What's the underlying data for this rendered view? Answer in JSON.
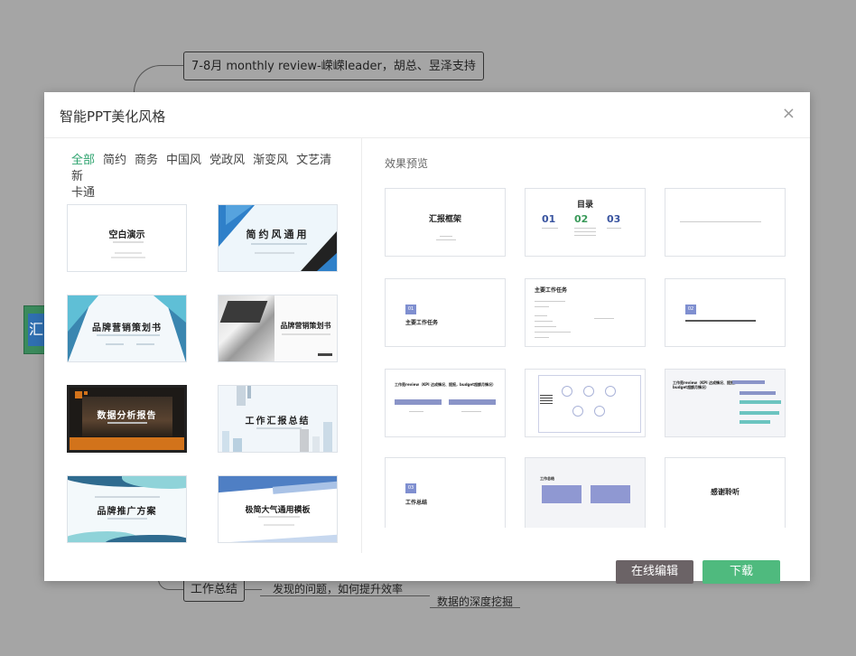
{
  "background": {
    "top_node": "7-8月 monthly review-嵘嵘leader，胡总、昱泽支持",
    "bottom_node": "工作总结",
    "bottom_branch_1": "发现的问题，如何提升效率",
    "bottom_branch_2": "数据的深度挖掘",
    "left_node_glyph": "汇"
  },
  "modal": {
    "title": "智能PPT美化风格",
    "close_glyph": "×",
    "categories": [
      "全部",
      "简约",
      "商务",
      "中国风",
      "党政风",
      "渐变风",
      "文艺清新",
      "卡通"
    ],
    "active_category": "全部",
    "templates": [
      {
        "title": "空白演示"
      },
      {
        "title": "简约风通用"
      },
      {
        "title": "品牌营销策划书"
      },
      {
        "title": "品牌营销策划书"
      },
      {
        "title": "数据分析报告"
      },
      {
        "title": "工作汇报总结"
      },
      {
        "title": "品牌推广方案"
      },
      {
        "title": "极简大气通用模板"
      }
    ],
    "preview_label": "效果预览",
    "slides": {
      "s1": "汇报框架",
      "s2_title": "目录",
      "s2_n1": "01",
      "s2_n2": "02",
      "s2_n3": "03",
      "s4_num": "01",
      "s4_title": "主要工作任务",
      "s5_title": "主要工作任务",
      "s6_num": "02",
      "s7_title": "工作是review（KPI 达成情况、提报，budget超额月情况）",
      "s9_title": "工作是review（KPI 达成情况、提报，budget超额月情况）",
      "s10_num": "03",
      "s10_title": "工作总结",
      "s11_title": "工作总结",
      "s12_title": "感谢聆听"
    },
    "buttons": {
      "edit": "在线编辑",
      "download": "下载"
    }
  },
  "colors": {
    "accent_green": "#4fba7e",
    "edit_button": "#6b6366",
    "active_category": "#2ea36f",
    "slide_blue": "#7f8fd0"
  }
}
